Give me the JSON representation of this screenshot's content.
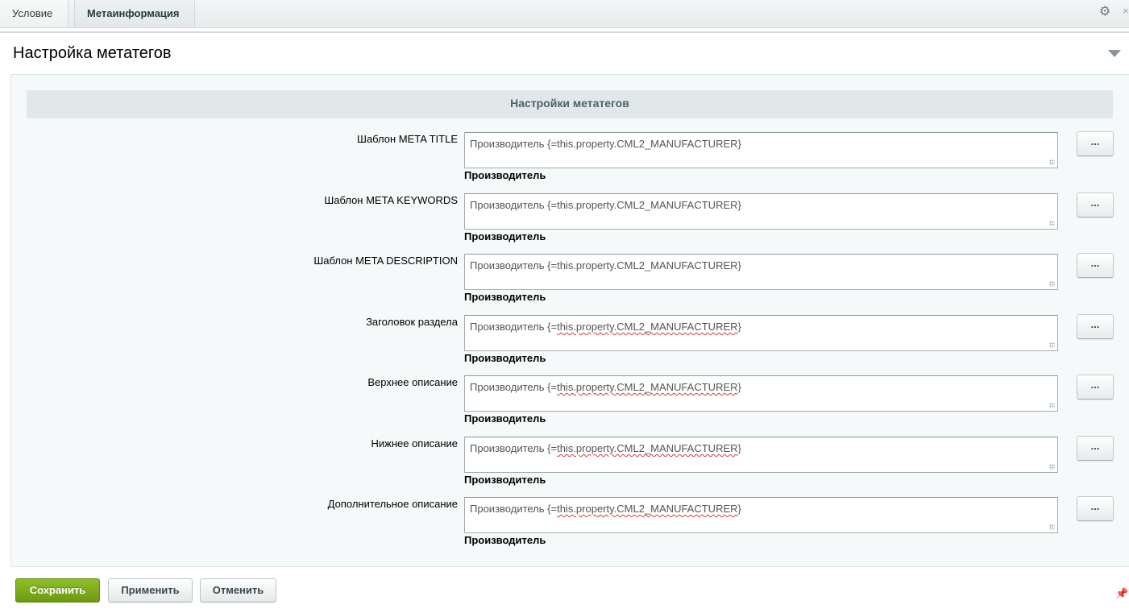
{
  "tabs": [
    {
      "label": "Условие",
      "active": false
    },
    {
      "label": "Метаинформация",
      "active": true
    }
  ],
  "icons": {
    "settings": "gear-icon",
    "close": "close-icon",
    "collapse": "chevron-down-icon",
    "pin": "pin-icon"
  },
  "section": {
    "title": "Настройка метатегов",
    "heading": "Настройки метатегов"
  },
  "fields": [
    {
      "label": "Шаблон META TITLE",
      "prefix": "Производитель {=",
      "middle": "this.property.CML2_MANUFACTURER",
      "suffix": "}",
      "spell_underline": false,
      "hint": "Производитель",
      "button": "..."
    },
    {
      "label": "Шаблон META KEYWORDS",
      "prefix": "Производитель {=",
      "middle": "this.property.CML2_MANUFACTURER",
      "suffix": "}",
      "spell_underline": false,
      "hint": "Производитель",
      "button": "..."
    },
    {
      "label": "Шаблон META DESCRIPTION",
      "prefix": "Производитель {=",
      "middle": "this.property.CML2_MANUFACTURER",
      "suffix": "}",
      "spell_underline": false,
      "hint": "Производитель",
      "button": "..."
    },
    {
      "label": "Заголовок раздела",
      "prefix": "Производитель {=",
      "middle": "this.property.CML2_MANUFACTURER",
      "suffix": "}",
      "spell_underline": true,
      "hint": "Производитель",
      "button": "..."
    },
    {
      "label": "Верхнее описание",
      "prefix": "Производитель {=",
      "middle": "this.property.CML2_MANUFACTURER",
      "suffix": "}",
      "spell_underline": true,
      "hint": "Производитель",
      "button": "..."
    },
    {
      "label": "Нижнее описание",
      "prefix": "Производитель {=",
      "middle": "this.property.CML2_MANUFACTURER",
      "suffix": "}",
      "spell_underline": true,
      "hint": "Производитель",
      "button": "..."
    },
    {
      "label": "Дополнительное описание",
      "prefix": "Производитель {=",
      "middle": "this.property.CML2_MANUFACTURER",
      "suffix": "}",
      "spell_underline": true,
      "hint": "Производитель",
      "button": "..."
    }
  ],
  "footer": {
    "save": "Сохранить",
    "apply": "Применить",
    "cancel": "Отменить"
  },
  "colors": {
    "save_button": "#7aa91b",
    "panel_background": "#f5f9f9",
    "heading_background": "#e0e8ea",
    "spellcheck_underline": "#d23c3c"
  }
}
